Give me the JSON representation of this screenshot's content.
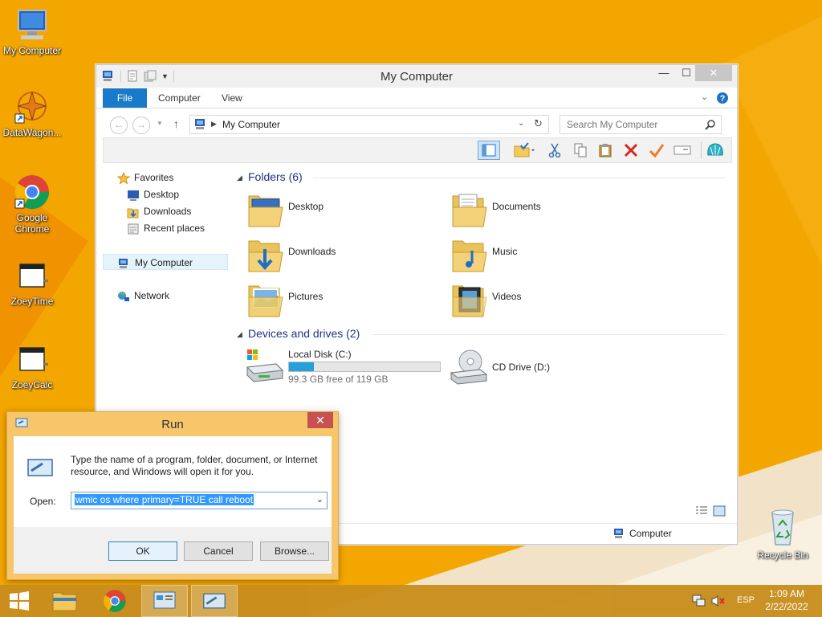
{
  "desktop": {
    "icons": [
      {
        "label": "My Computer"
      },
      {
        "label": "DataWagon..."
      },
      {
        "label": "Google Chrome"
      },
      {
        "label": "ZoeyTime"
      },
      {
        "label": "ZoeyCalc"
      },
      {
        "label": "Recycle Bin"
      }
    ]
  },
  "explorer": {
    "title": "My Computer",
    "window_buttons": {
      "minimize": "—",
      "maximize": "☐",
      "close": "✕"
    },
    "tabs": [
      "File",
      "Computer",
      "View"
    ],
    "address": "My Computer",
    "search_placeholder": "Search My Computer",
    "nav": {
      "favorites": "Favorites",
      "desktop": "Desktop",
      "downloads": "Downloads",
      "recent": "Recent places",
      "computer": "My Computer",
      "network": "Network"
    },
    "folders_header": "Folders (6)",
    "folders": [
      "Desktop",
      "Documents",
      "Downloads",
      "Music",
      "Pictures",
      "Videos"
    ],
    "devices_header": "Devices and drives (2)",
    "drives": {
      "c": {
        "name": "Local Disk (C:)",
        "free_text": "99.3 GB free of 119 GB",
        "used_fraction": 0.166
      },
      "d": {
        "name": "CD Drive (D:)"
      }
    },
    "status_computer": "Computer"
  },
  "run": {
    "title": "Run",
    "close": "✕",
    "description": "Type the name of a program, folder, document, or Internet resource, and Windows will open it for you.",
    "open_label": "Open:",
    "command": "wmic os where primary=TRUE call reboot",
    "ok": "OK",
    "cancel": "Cancel",
    "browse": "Browse..."
  },
  "taskbar": {
    "language": "ESP",
    "time": "1:09 AM",
    "date": "2/22/2022"
  },
  "colors": {
    "desktop_bg": "#f5a700",
    "accent_blue": "#1979ca",
    "run_frame": "#f7c66a"
  }
}
